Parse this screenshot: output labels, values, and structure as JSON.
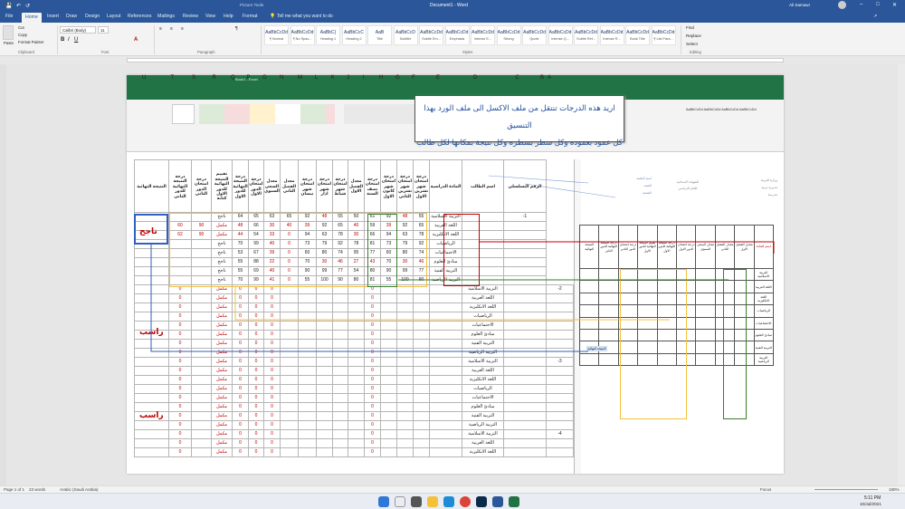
{
  "window": {
    "title": "Document1  -  Word",
    "contextual_group": "Picture Tools",
    "user": "Ali Samawi"
  },
  "quick_access": {
    "save_icon": "save-icon",
    "undo_icon": "undo-icon",
    "redo_icon": "redo-icon"
  },
  "tabs": [
    "File",
    "Home",
    "Insert",
    "Draw",
    "Design",
    "Layout",
    "References",
    "Mailings",
    "Review",
    "View",
    "Help",
    "Format"
  ],
  "active_tab": "Home",
  "tell_me": "Tell me what you want to do",
  "ribbon": {
    "clipboard": {
      "paste": "Paste",
      "cut": "Cut",
      "copy": "Copy",
      "format_painter": "Format Painter",
      "label": "Clipboard"
    },
    "font": {
      "name": "Calibri (Body)",
      "size": "11",
      "label": "Font"
    },
    "paragraph": {
      "label": "Paragraph"
    },
    "styles": {
      "label": "Styles",
      "items": [
        {
          "preview": "AaBbCcDd",
          "name": "¶ Normal"
        },
        {
          "preview": "AaBbCcDd",
          "name": "¶ No Spac..."
        },
        {
          "preview": "AaBbC(",
          "name": "Heading 1"
        },
        {
          "preview": "AaBbCcC",
          "name": "Heading 2"
        },
        {
          "preview": "AaB",
          "name": "Title"
        },
        {
          "preview": "AaBbCcD",
          "name": "Subtitle"
        },
        {
          "preview": "AaBbCcDd",
          "name": "Subtle Em..."
        },
        {
          "preview": "AaBbCcDd",
          "name": "Emphasis"
        },
        {
          "preview": "AaBbCcDd",
          "name": "Intense E..."
        },
        {
          "preview": "AaBbCcDd",
          "name": "Strong"
        },
        {
          "preview": "AaBbCcDd",
          "name": "Quote"
        },
        {
          "preview": "AaBbCcDd",
          "name": "Intense Q..."
        },
        {
          "preview": "AaBbCcDd",
          "name": "Subtle Ref..."
        },
        {
          "preview": "AaBbCcDd",
          "name": "Intense R..."
        },
        {
          "preview": "AaBbCcDd",
          "name": "Book Title"
        },
        {
          "preview": "AaBbCcDd",
          "name": "¶ List Para..."
        }
      ]
    },
    "editing": {
      "find": "Find",
      "replace": "Replace",
      "select": "Select",
      "label": "Editing"
    }
  },
  "callout": {
    "line1": "اريد هذه الدرجات تنتقل من ملف الاكسل الى ملف الورد بهذا التنسيق",
    "line2": "كل عمود بعموده وكل سطر بسطره وكل نتيجة بمكانها لكل طالب"
  },
  "excel": {
    "title": "Book1 - Excel",
    "col_letters": [
      "U",
      "T",
      "S",
      "R",
      "Q",
      "P",
      "O",
      "N",
      "M",
      "L",
      "K",
      "J",
      "I",
      "H",
      "G",
      "F",
      "E",
      "D",
      "C",
      "B",
      "A"
    ],
    "headers": [
      "النتيجة النهائية",
      "درجة النتيجة النهائية للدور الثاني",
      "درجة امتحان الدور الثاني",
      "تقييم النتيجة النهائية للدور الاول كتابة",
      "درجة النتيجة النهائية للدور الاول",
      "درجة امتحان الدور الاول",
      "معدل السعي السنوي",
      "معدل الفصل الثاني",
      "درجة امتحان شهر نيسان",
      "درجة امتحان شهر اذار",
      "درجة امتحان شهر شباط",
      "معدل الفصل الاول",
      "درجة امتحان نصف السنة",
      "درجة امتحان شهر كانون الاول",
      "درجة امتحان شهر تشرين الثاني",
      "درجة امتحان شهر تشرين الاول",
      "المادة الدراسية",
      "اسم الطالب",
      "الرقم التسلسلي"
    ],
    "subjects": [
      "التربية الاسلامية",
      "اللغة العربية",
      "اللغة الانكليزية",
      "الرياضيات",
      "الاجتماعيات",
      "مبادئ العلوم",
      "التربية الفنية",
      "التربية الرياضية"
    ],
    "student1": {
      "serial": "-1",
      "rows": [
        [
          "",
          "",
          "",
          "ناجح",
          "64",
          "65",
          "63",
          "65",
          "92",
          "48",
          "55",
          "50",
          "61",
          "92",
          "48",
          "55"
        ],
        [
          "",
          "60",
          "90",
          "مكمل",
          "48",
          "66",
          "30",
          "40",
          "39",
          "92",
          "65",
          "40",
          "59",
          "39",
          "92",
          "65"
        ],
        [
          "",
          "62",
          "90",
          "مكمل",
          "44",
          "54",
          "33",
          "0",
          "94",
          "63",
          "78",
          "30",
          "66",
          "94",
          "63",
          "78"
        ],
        [
          "",
          "",
          "",
          "ناجح",
          "70",
          "99",
          "40",
          "0",
          "73",
          "79",
          "92",
          "78",
          "81",
          "73",
          "79",
          "92"
        ],
        [
          "",
          "",
          "",
          "ناجح",
          "53",
          "67",
          "39",
          "0",
          "60",
          "80",
          "74",
          "95",
          "77",
          "60",
          "80",
          "74"
        ],
        [
          "",
          "",
          "",
          "ناجح",
          "55",
          "88",
          "22",
          "0",
          "70",
          "30",
          "46",
          "27",
          "43",
          "70",
          "30",
          "46"
        ],
        [
          "",
          "",
          "",
          "ناجح",
          "55",
          "69",
          "40",
          "0",
          "90",
          "99",
          "77",
          "54",
          "80",
          "90",
          "99",
          "77"
        ],
        [
          "",
          "",
          "",
          "ناجح",
          "70",
          "99",
          "41",
          "0",
          "55",
          "100",
          "90",
          "80",
          "81",
          "55",
          "100",
          "90"
        ]
      ],
      "tail": [
        "50",
        "40",
        "30",
        "78",
        "95",
        "27",
        "54",
        "80"
      ],
      "result": "ناجح"
    },
    "student2": {
      "serial": "-2",
      "status": "مكمل",
      "zero": "0",
      "result": "راسب"
    },
    "student3": {
      "serial": "-3",
      "status": "مكمل",
      "zero": "0",
      "result": "راسب"
    },
    "student4": {
      "serial": "-4",
      "status": "مكمل",
      "zero": "0"
    },
    "sheet_tab": "Sheet1"
  },
  "word_table": {
    "headers": [
      "معدل الفصل الاول",
      "معدل الفصل الثاني",
      "معدل السعي السنوي",
      "درجة امتحان الدور الاول",
      "درجة النتيجة النهائية للدور الاول",
      "تقييم النتيجة النهائية للدور الاول",
      "درجة امتحان الدور الثاني",
      "درجة النتيجة النهائية للدور الثاني",
      "النتيجة النهائية"
    ],
    "row_label": "اسم المادة",
    "subjects": [
      "التربية الاسلامية",
      "اللغة العربية",
      "اللغة الانكليزية",
      "الرياضيات",
      "الاجتماعيات",
      "مبادئ العلوم",
      "التربية الفنية",
      "التربية الرياضية"
    ],
    "result_label": "النتيجة النهائية"
  },
  "header_block": {
    "left_lines": [
      "وزارة التربية",
      "مديرية تربية",
      "مدرسة"
    ],
    "mid_lines": [
      "الشهادة الابتدائية",
      "للعام الدراسي"
    ],
    "right_lines": [
      "اسم التلميذ",
      "الصف",
      "الشعبة"
    ]
  },
  "status": {
    "page": "Page 1 of 1",
    "words": "23 words",
    "language": "Arabic (Saudi Arabia)",
    "focus": "Focus",
    "zoom": "180%"
  },
  "taskbar": {
    "time": "5:11 PM",
    "date": "10/Jul/2021",
    "icons": [
      "start-icon",
      "search-icon",
      "task-view-icon",
      "file-explorer-icon",
      "edge-icon",
      "chrome-icon",
      "photoshop-icon",
      "word-icon",
      "excel-icon"
    ]
  },
  "colors": {
    "word_blue": "#2b579a",
    "excel_green": "#217346",
    "red": "#c00000",
    "yellow": "#f0c040",
    "green": "#3a7d2a",
    "blue": "#2f5fbf"
  }
}
